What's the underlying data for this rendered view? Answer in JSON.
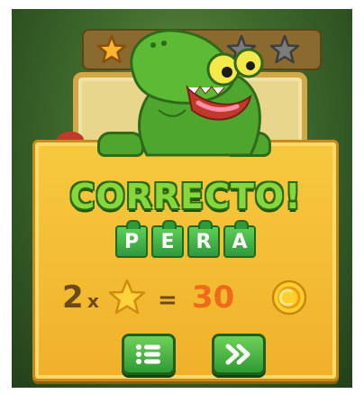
{
  "result": {
    "title": "CORRECTO!",
    "word_letters": [
      "P",
      "E",
      "R",
      "A"
    ],
    "multiplier": "2",
    "times_sign": "x",
    "equals_sign": "=",
    "points": "30"
  },
  "stars": {
    "total": 5,
    "earned": 1
  },
  "colors": {
    "panel": "#f4be34",
    "title_green": "#86d63e",
    "tag_green": "#2f9a3a",
    "points_orange": "#ef6a1a",
    "button_green": "#3fae3a"
  },
  "icons": {
    "menu_button": "list-icon",
    "next_button": "fast-forward-icon",
    "currency": "coin-icon",
    "score_star": "star-icon"
  }
}
